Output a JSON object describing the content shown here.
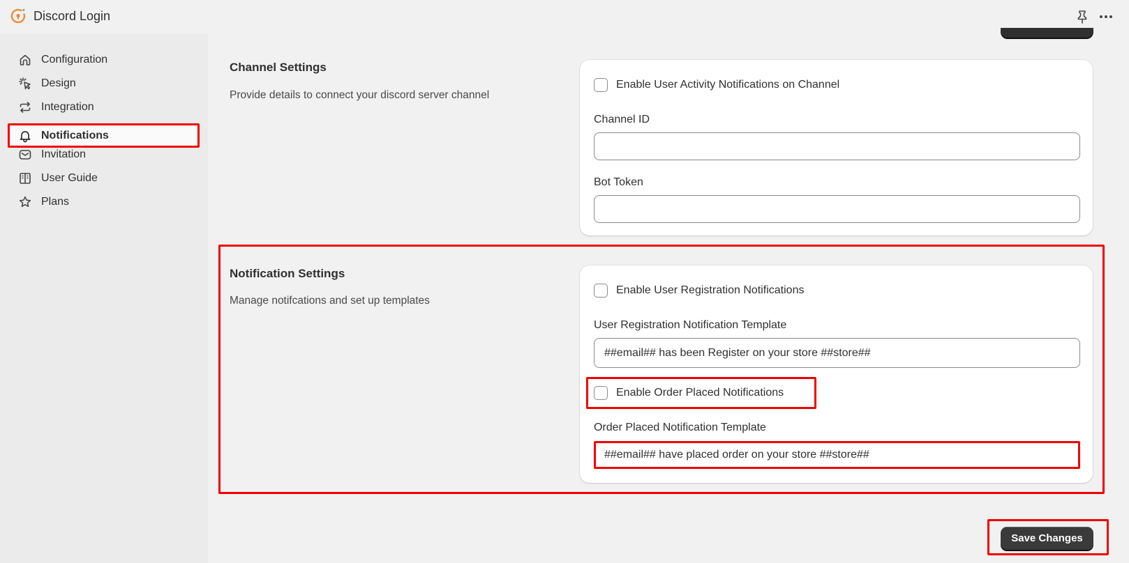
{
  "app": {
    "title": "Discord Login",
    "logo_icon": "orange-circle-keyhole-logo",
    "header_actions": [
      {
        "name": "pin",
        "icon": "pin-icon"
      },
      {
        "name": "more",
        "icon": "more-horizontal-icon"
      }
    ]
  },
  "sidebar": {
    "items": [
      {
        "label": "Configuration",
        "icon": "home-icon",
        "active": false
      },
      {
        "label": "Design",
        "icon": "cursor-click-icon",
        "active": false
      },
      {
        "label": "Integration",
        "icon": "repeat-arrows-icon",
        "active": false
      },
      {
        "label": "Notifications",
        "icon": "bell-icon",
        "active": true
      },
      {
        "label": "Invitation",
        "icon": "envelope-icon",
        "active": false
      },
      {
        "label": "User Guide",
        "icon": "book-icon",
        "active": false
      },
      {
        "label": "Plans",
        "icon": "star-icon",
        "active": false
      }
    ]
  },
  "channel_settings": {
    "title": "Channel Settings",
    "description": "Provide details to connect your discord server channel",
    "enable_checkbox": {
      "label": "Enable User Activity Notifications on Channel",
      "checked": false
    },
    "channel_id": {
      "label": "Channel ID",
      "value": ""
    },
    "bot_token": {
      "label": "Bot Token",
      "value": ""
    }
  },
  "notification_settings": {
    "title": "Notification Settings",
    "description": "Manage notifcations and set up templates",
    "registration_checkbox": {
      "label": "Enable User Registration Notifications",
      "checked": false
    },
    "registration_template": {
      "label": "User Registration Notification Template",
      "value": "##email## has been Register on your store ##store##"
    },
    "order_checkbox": {
      "label": "Enable Order Placed Notifications",
      "checked": false
    },
    "order_template": {
      "label": "Order Placed Notification Template",
      "value": "##email## have placed order on your store ##store##"
    }
  },
  "actions": {
    "save_label": "Save Changes"
  },
  "colors": {
    "annotation": "#f20000",
    "primary_button": "#3a3a3a",
    "logo_orange": "#f08a3c",
    "logo_green": "#5cb85c"
  }
}
